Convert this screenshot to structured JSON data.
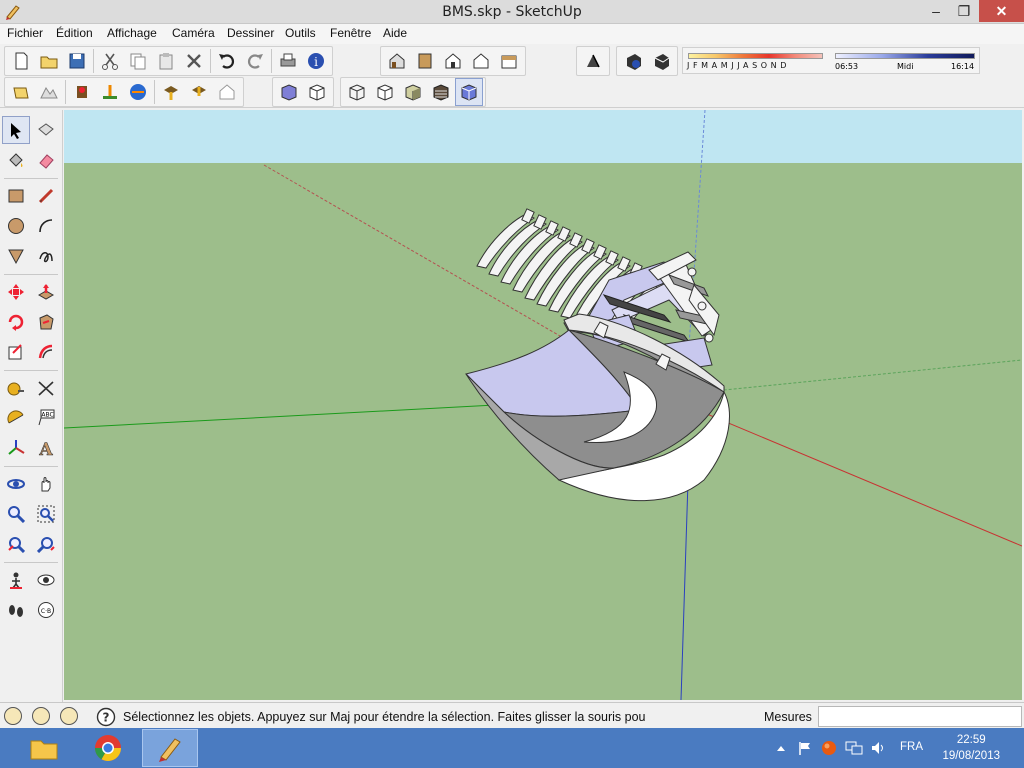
{
  "window": {
    "title": "BMS.skp - SketchUp",
    "minimize_glyph": "–",
    "maximize_glyph": "❐",
    "close_glyph": "✕"
  },
  "menu": {
    "items": [
      "Fichier",
      "Édition",
      "Affichage",
      "Caméra",
      "Dessiner",
      "Outils",
      "Fenêtre",
      "Aide"
    ]
  },
  "shadows": {
    "months": "JFMAMJJASOND",
    "time_start": "06:53",
    "time_mid": "Midi",
    "time_end": "16:14"
  },
  "status": {
    "hint": "Sélectionnez les objets. Appuyez sur Maj pour étendre la sélection. Faites glisser la souris pou",
    "measures_label": "Mesures",
    "measures_value": ""
  },
  "taskbar": {
    "language": "FRA",
    "time": "22:59",
    "date": "19/08/2013"
  },
  "colors": {
    "sky": "#bfe6f2",
    "ground": "#9dbe8b",
    "axis_red": "#c83232",
    "axis_green": "#1a9a1a",
    "axis_blue": "#2a3fbf",
    "bucket_inside": "#c8c8ee",
    "taskbar": "#4a7bc1"
  }
}
